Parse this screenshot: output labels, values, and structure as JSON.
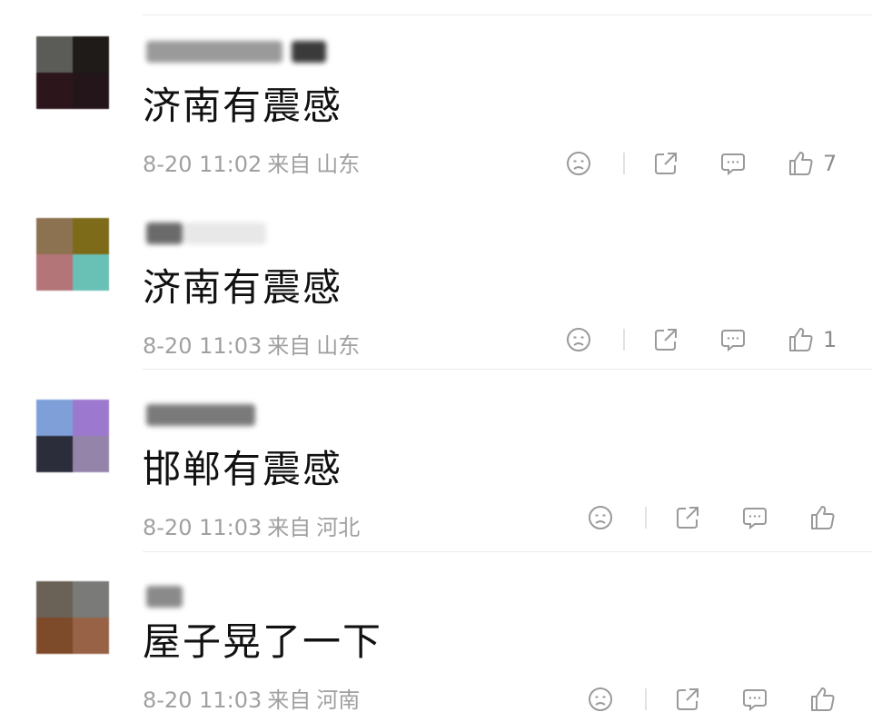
{
  "comments": [
    {
      "text": "济南有震感",
      "time": "8-20 11:02",
      "from_label": "来自",
      "location": "山东",
      "likes": "7",
      "avatar_colors": [
        "#5b5b58",
        "#1e1b18",
        "#2d161b",
        "#24151a"
      ],
      "username_colors": [
        "#9a9a9a",
        "#3a3a3a"
      ]
    },
    {
      "text": "济南有震感",
      "time": "8-20 11:03",
      "from_label": "来自",
      "location": "山东",
      "likes": "1",
      "avatar_colors": [
        "#8c7250",
        "#7e6b19",
        "#b37577",
        "#69c0b5"
      ],
      "username_colors": [
        "#6a6a6a"
      ]
    },
    {
      "text": "邯郸有震感",
      "time": "8-20 11:03",
      "from_label": "来自",
      "location": "河北",
      "likes": "",
      "avatar_colors": [
        "#7e9fd7",
        "#9c79cf",
        "#2b2d3a",
        "#9484aa"
      ],
      "username_colors": [
        "#7a7a7a"
      ]
    },
    {
      "text": "屋子晃了一下",
      "time": "8-20 11:03",
      "from_label": "来自",
      "location": "河南",
      "likes": "",
      "avatar_colors": [
        "#6a6256",
        "#7a7b78",
        "#7d4a2a",
        "#976246"
      ],
      "username_colors": [
        "#8a8a8a"
      ]
    }
  ],
  "icons": {
    "dislike": "sad-face-icon",
    "share": "share-icon",
    "comment": "comment-icon",
    "like": "thumbs-up-icon"
  }
}
